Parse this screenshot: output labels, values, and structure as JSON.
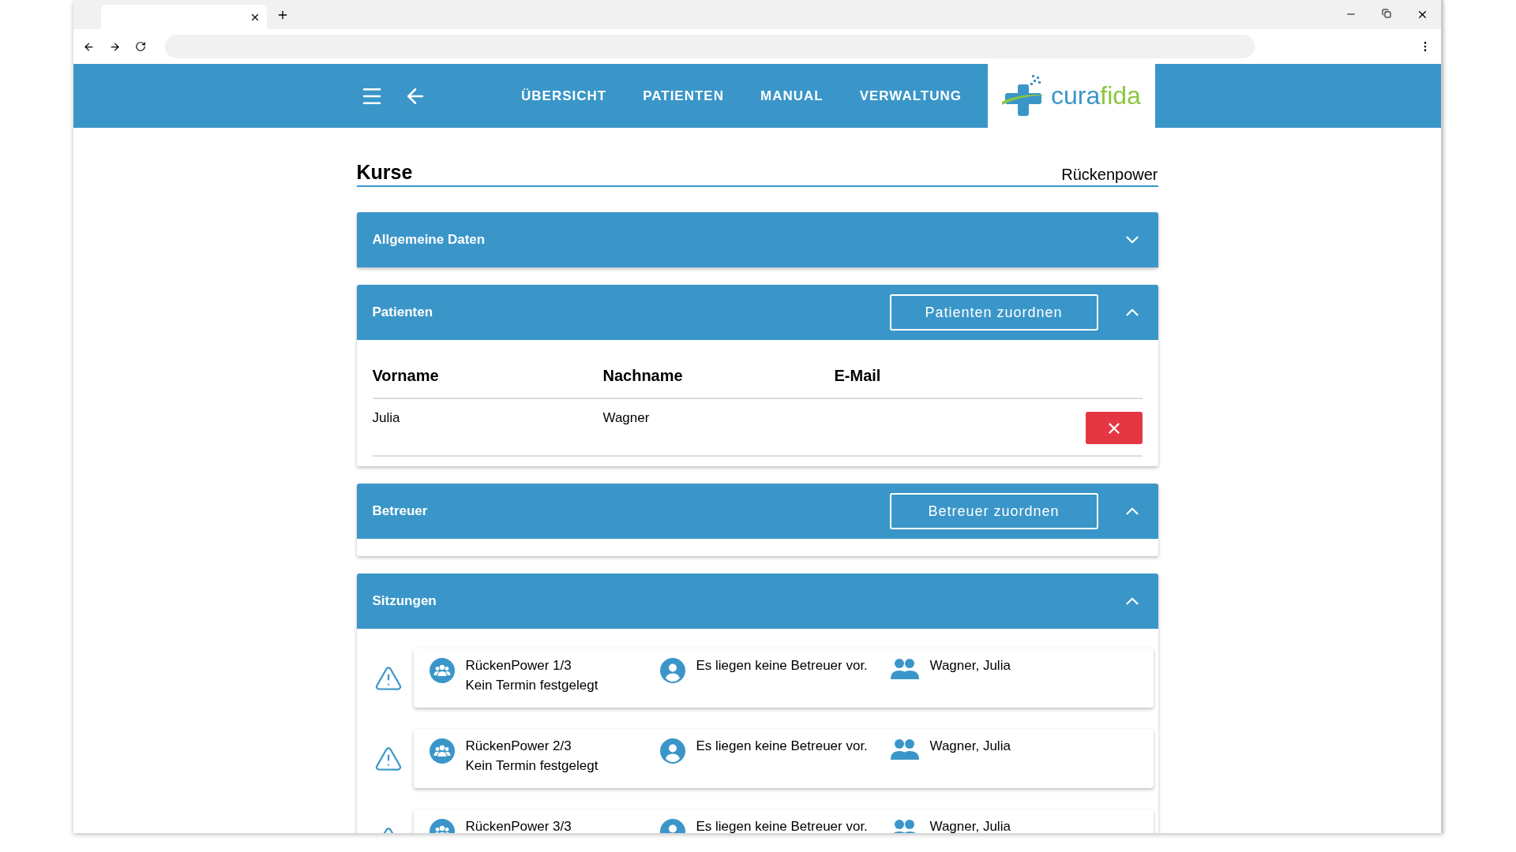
{
  "nav": {
    "items": [
      {
        "label": "ÜBERSICHT"
      },
      {
        "label": "PATIENTEN"
      },
      {
        "label": "MANUAL"
      },
      {
        "label": "VERWALTUNG"
      }
    ]
  },
  "logo": {
    "parts": [
      {
        "text": "cura",
        "color": "#3a96c9"
      },
      {
        "text": "fida",
        "color": "#8dc63f"
      }
    ]
  },
  "page": {
    "title": "Kurse",
    "subtitle": "Rückenpower"
  },
  "panels": [
    {
      "title": "Allgemeine Daten",
      "expanded": false
    },
    {
      "kind": "table",
      "title": "Patienten",
      "expanded": true,
      "button": "Patienten zuordnen",
      "columns": [
        "Vorname",
        "Nachname",
        "E-Mail"
      ],
      "rows": [
        {
          "cells": [
            "Julia",
            "Wagner"
          ]
        }
      ]
    },
    {
      "kind": "plain",
      "title": "Betreuer",
      "expanded": true,
      "button": "Betreuer zuordnen"
    },
    {
      "kind": "sessions",
      "title": "Sitzungen",
      "expanded": true,
      "sessions": [
        {
          "title": "RückenPower 1/3",
          "date": "Kein Termin festgelegt",
          "supervisors": "Es liegen keine Betreuer vor.",
          "participants": "Wagner, Julia",
          "warning": true
        },
        {
          "title": "RückenPower 2/3",
          "date": "Kein Termin festgelegt",
          "supervisors": "Es liegen keine Betreuer vor.",
          "participants": "Wagner, Julia",
          "warning": true
        },
        {
          "title": "RückenPower 3/3",
          "supervisors": "Es liegen keine Betreuer vor.",
          "participants": "Wagner, Julia",
          "warning": true
        }
      ]
    }
  ]
}
